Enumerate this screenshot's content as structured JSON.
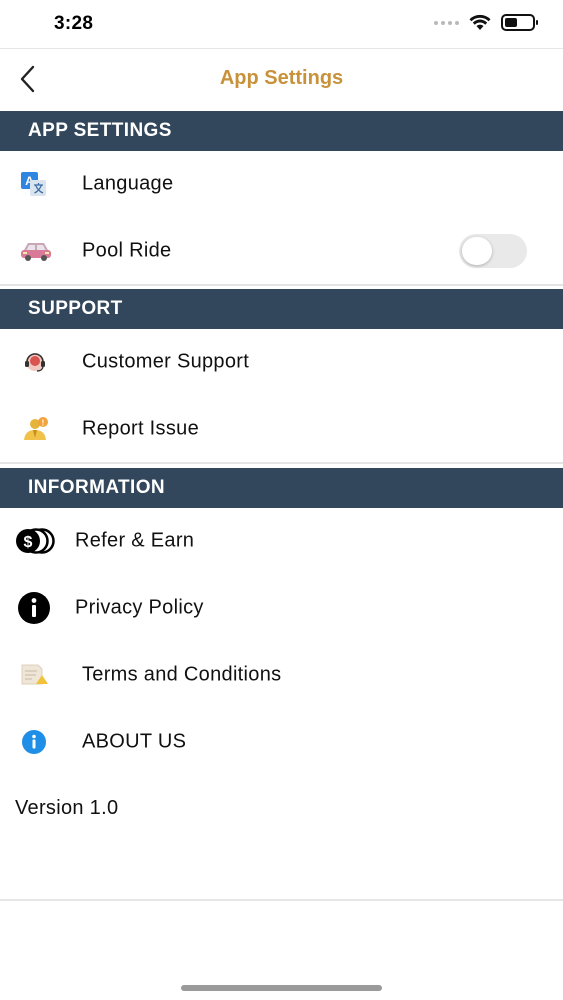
{
  "status_bar": {
    "time": "3:28",
    "battery_level": 0.45
  },
  "nav": {
    "title": "App Settings",
    "title_color": "#c8923a",
    "back_icon": "chevron-left-icon"
  },
  "theme": {
    "header_bg": "#32475c",
    "header_text": "#ffffff"
  },
  "sections": {
    "app_settings": {
      "header": "APP SETTINGS",
      "items": [
        {
          "label": "Language",
          "icon": "translate-icon"
        },
        {
          "label": "Pool Ride",
          "icon": "car-icon",
          "toggle_on": false
        }
      ]
    },
    "support": {
      "header": "SUPPORT",
      "items": [
        {
          "label": "Customer Support",
          "icon": "headset-icon"
        },
        {
          "label": "Report Issue",
          "icon": "person-issue-icon"
        }
      ]
    },
    "information": {
      "header": "INFORMATION",
      "items": [
        {
          "label": "Refer & Earn",
          "icon": "coins-icon"
        },
        {
          "label": "Privacy Policy",
          "icon": "info-circle-icon"
        },
        {
          "label": "Terms and Conditions",
          "icon": "document-icon"
        },
        {
          "label": "ABOUT US",
          "icon": "about-info-icon"
        }
      ]
    }
  },
  "version": "Version 1.0"
}
